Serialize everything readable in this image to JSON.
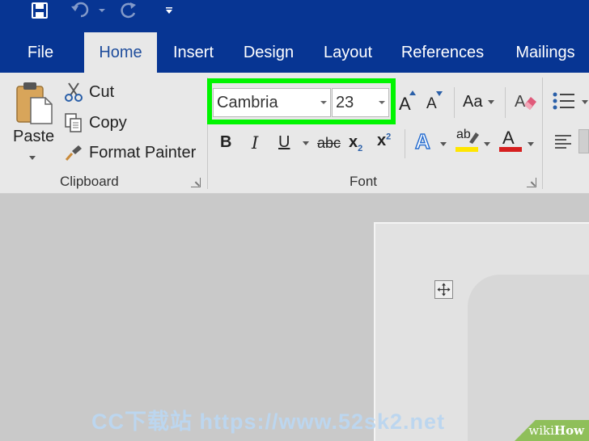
{
  "quick_access": {
    "icons": [
      "save-icon",
      "undo-icon",
      "redo-icon",
      "customize-icon"
    ]
  },
  "tabs": [
    {
      "label": "File",
      "active": false
    },
    {
      "label": "Home",
      "active": true
    },
    {
      "label": "Insert",
      "active": false
    },
    {
      "label": "Design",
      "active": false
    },
    {
      "label": "Layout",
      "active": false
    },
    {
      "label": "References",
      "active": false
    },
    {
      "label": "Mailings",
      "active": false
    }
  ],
  "clipboard": {
    "paste": "Paste",
    "cut": "Cut",
    "copy": "Copy",
    "format_painter": "Format Painter",
    "group_label": "Clipboard"
  },
  "font": {
    "font_name": "Cambria",
    "font_size": "23",
    "group_label": "Font",
    "change_case": "Aa",
    "strikethrough": "abc",
    "bold": "B",
    "italic": "I",
    "underline": "U",
    "subscript": "x",
    "subscript_index": "2",
    "superscript": "x",
    "superscript_index": "2",
    "grow": "A",
    "shrink": "A",
    "text_effects": "A",
    "highlight": "ab",
    "font_color": "A"
  },
  "colors": {
    "ribbon_blue": "#073593",
    "highlight_box": "#00f500",
    "highlight_yellow": "#ffe600",
    "font_color_red": "#d61f1f"
  },
  "watermark": "CC下载站 https://www.52sk2.net",
  "brand": {
    "wiki": "wiki",
    "how": "How"
  }
}
